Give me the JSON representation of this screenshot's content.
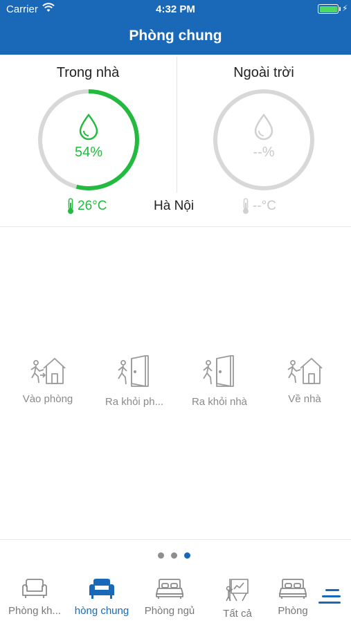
{
  "status_bar": {
    "carrier": "Carrier",
    "time": "4:32 PM",
    "battery_color": "#4cd964"
  },
  "nav": {
    "title": "Phòng chung"
  },
  "indoor": {
    "title": "Trong nhà",
    "humidity": "54%",
    "humidity_fraction": 0.54,
    "temperature": "26°C",
    "color": "#22bb3f"
  },
  "outdoor": {
    "title": "Ngoài trời",
    "humidity": "--%",
    "temperature": "--°C",
    "color": "#d0d0d0"
  },
  "location": {
    "city": "Hà Nội"
  },
  "scenes": [
    {
      "label": "Vào phòng",
      "icon": "enter-home-icon"
    },
    {
      "label": "Ra khỏi ph...",
      "icon": "exit-door-icon"
    },
    {
      "label": "Ra khỏi nhà",
      "icon": "exit-door-icon"
    },
    {
      "label": "Về nhà",
      "icon": "return-home-icon"
    }
  ],
  "pagination": {
    "pages": 3,
    "current": 3
  },
  "tabs": [
    {
      "label": "Phòng kh...",
      "icon": "sofa-icon"
    },
    {
      "label": "hòng chung",
      "icon": "armchair-icon",
      "active": true
    },
    {
      "label": "Phòng ngủ",
      "icon": "bed-icon"
    },
    {
      "label": "Tất cả",
      "icon": "presentation-board-icon"
    },
    {
      "label": "Phòng",
      "icon": "bed-icon"
    }
  ],
  "colors": {
    "primary": "#1a68b8",
    "green": "#22bb3f",
    "gauge_track": "#d8d8d8",
    "inactive_icon": "#9a9a9a"
  }
}
